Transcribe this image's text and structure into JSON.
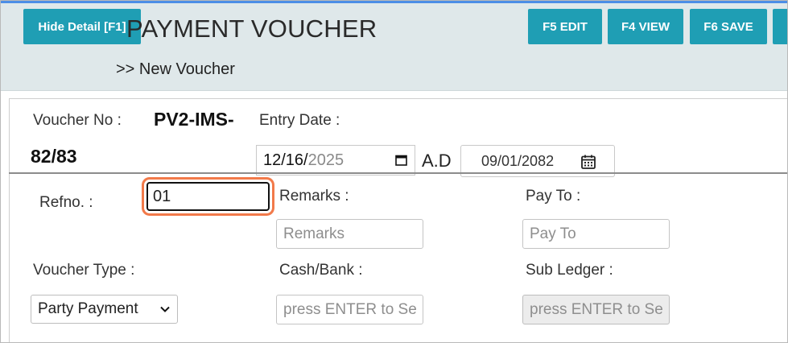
{
  "toolbar": {
    "hide_detail": "Hide Detail [F1]",
    "edit": "F5 EDIT",
    "view": "F4 VIEW",
    "save": "F6 SAVE"
  },
  "header": {
    "title": "PAYMENT VOUCHER",
    "breadcrumb": ">> New Voucher"
  },
  "form": {
    "voucher_no_label": "Voucher No :",
    "voucher_no_value_1": "PV2-IMS-",
    "voucher_no_value_2": "82/83",
    "entry_date_label": "Entry Date :",
    "entry_date": {
      "md": "12/16/",
      "year": "2025"
    },
    "ad_label": "A.D",
    "nepali_date": "09/01/2082",
    "refno_label": "Refno. :",
    "refno_value": "01",
    "remarks_label": "Remarks :",
    "remarks_placeholder": "Remarks",
    "payto_label": "Pay To :",
    "payto_placeholder": "Pay To",
    "voucher_type_label": "Voucher Type :",
    "voucher_type_value": "Party Payment",
    "cashbank_label": "Cash/Bank :",
    "cashbank_placeholder": "press ENTER to Se",
    "subledger_label": "Sub Ledger :",
    "subledger_placeholder": "press ENTER to Se"
  },
  "colors": {
    "accent": "#1f9eb4",
    "header_bg": "#dfe8ea",
    "focus_ring": "#f27a4a"
  }
}
